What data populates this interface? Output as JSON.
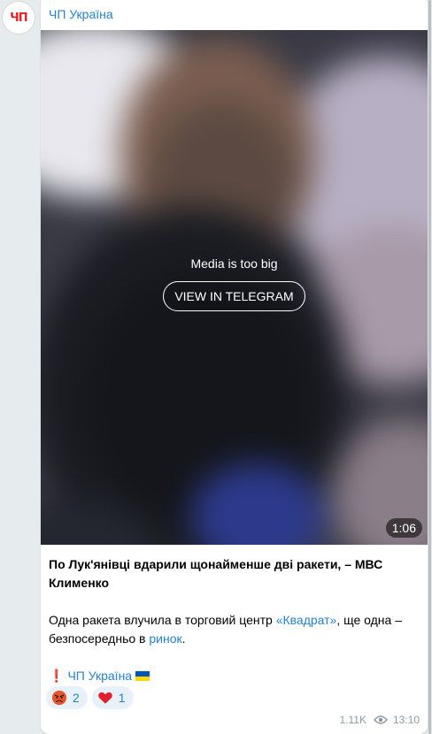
{
  "channel": {
    "name": "ЧП Україна",
    "avatar_text": "ЧП"
  },
  "media": {
    "message": "Media is too big",
    "button_label": "VIEW IN TELEGRAM",
    "duration": "1:06"
  },
  "post": {
    "headline": "По Лук'янівці вдарили щонайменше дві ракети, – МВС Клименко",
    "body_prefix": "Одна ракета влучила в торговий центр ",
    "link1": "«Квадрат»",
    "body_middle": ", ще одна – безпосередньо в ",
    "link2": "ринок",
    "body_suffix": ".",
    "signature_mark": "❗",
    "signature_link": "ЧП Україна"
  },
  "reactions": [
    {
      "icon": "angry-face-icon",
      "count": "2"
    },
    {
      "icon": "heart-icon",
      "count": "1"
    }
  ],
  "meta": {
    "views": "1.11K",
    "time": "13:10"
  },
  "colors": {
    "accent": "#2481cc",
    "background": "#e6ebee",
    "bubble": "#ffffff"
  }
}
